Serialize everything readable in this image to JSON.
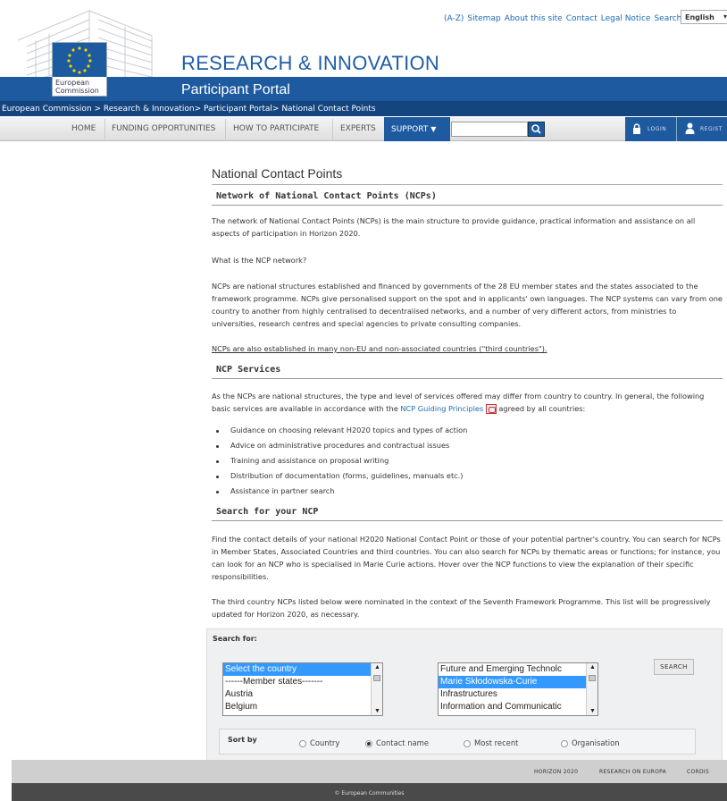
{
  "header": {
    "logo_line1": "European",
    "logo_line2": "Commission",
    "site_title": "RESEARCH & INNOVATION",
    "portal_title": "Participant Portal",
    "top_links": [
      "(A-Z)",
      "Sitemap",
      "About this site",
      "Contact",
      "Legal Notice",
      "Search"
    ],
    "language": "English"
  },
  "breadcrumb": {
    "items": [
      "European Commission",
      "Research & Innovation",
      "Participant Portal",
      "National Contact Points"
    ],
    "sep1": " > ",
    "sep2": "> ",
    "sep3": "> "
  },
  "nav": {
    "items": [
      "HOME",
      "FUNDING OPPORTUNITIES",
      "HOW TO PARTICIPATE",
      "EXPERTS"
    ],
    "support": "SUPPORT",
    "search_value": "",
    "login": "LOGIN",
    "register": "REGIST"
  },
  "page": {
    "title": "National Contact Points",
    "section1": {
      "heading": "Network of National Contact Points (NCPs)",
      "p1": "The network of National Contact Points (NCPs) is the main structure to provide guidance, practical information and assistance on all aspects of participation in Horizon 2020.",
      "p2": "What is the NCP network?",
      "p3": "NCPs are national structures established and financed by governments of the 28 EU member states and the states associated to the framework programme. NCPs give personalised support on the spot and in applicants' own languages. The NCP systems can vary from one country to another from highly centralised to decentralised networks, and a number of very different actors, from ministries to universities, research centres and special agencies to private consulting companies.",
      "p4": "NCPs are also established in many non-EU and non-associated countries (\"third countries\")."
    },
    "section2": {
      "heading": "NCP Services",
      "p1_before": "As the NCPs are national structures, the type and level of services offered may differ from country to country. In general, the following basic services are available in accordance with the",
      "p1_link": "NCP Guiding Principles",
      "p1_after": "agreed by all countries:",
      "bullets": [
        "Guidance on choosing relevant H2020 topics and types of action",
        "Advice on administrative procedures and contractual issues",
        "Training and assistance on proposal writing",
        "Distribution of documentation (forms, guidelines, manuals etc.)",
        "Assistance in partner search"
      ]
    },
    "section3": {
      "heading": "Search for your NCP",
      "p1": "Find the contact details of your national H2020 National Contact Point or those of your potential partner's country. You can search for NCPs in Member States, Associated Countries and third countries. You can also search for NCPs by thematic areas or functions; for instance, you can look for an NCP who is specialised in Marie Curie actions. Hover over the NCP functions to view the explanation of their specific responsibilities.",
      "p2": "The third country NCPs listed below were nominated in the context of the Seventh Framework Programme. This list will be progressively updated for Horizon 2020, as necessary."
    }
  },
  "search": {
    "label": "Search for:",
    "countries": [
      "Select the country",
      "------Member states-------",
      "Austria",
      "Belgium"
    ],
    "themes": [
      "Future and Emerging Technolc",
      "Marie Skłodowska-Curie",
      "Infrastructures",
      "Information and Communicatic"
    ],
    "button": "SEARCH",
    "sort_label": "Sort by",
    "sort_options": [
      "Country",
      "Contact name",
      "Most recent",
      "Organisation"
    ],
    "sort_selected": "Contact name"
  },
  "footer": {
    "links": [
      "HORIZON 2020",
      "RESEARCH ON EUROPA",
      "CORDIS"
    ],
    "copyright": "© European Communities"
  },
  "colors": {
    "brand_blue": "#1e5aa0",
    "dark_blue": "#15457f",
    "link_blue": "#1a6bb4",
    "selection_blue": "#3399ff"
  }
}
